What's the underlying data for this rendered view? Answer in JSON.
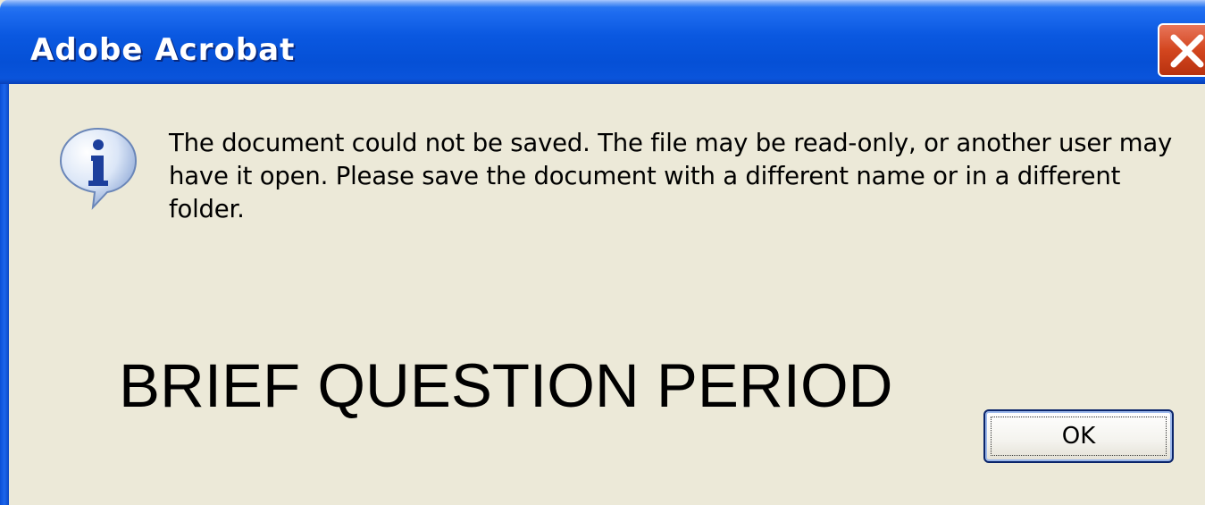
{
  "window": {
    "title": "Adobe Acrobat"
  },
  "dialog": {
    "icon": "info-icon",
    "message": "The document could not be saved. The file may be read-only, or another user may have it open. Please save the document with a different name or in a different folder.",
    "ok_label": "OK"
  },
  "overlay": {
    "text": "BRIEF QUESTION PERIOD"
  },
  "colors": {
    "titlebar": "#0a58e0",
    "body": "#ece9d8",
    "close_button": "#d3461f",
    "ok_border": "#0a246a"
  }
}
